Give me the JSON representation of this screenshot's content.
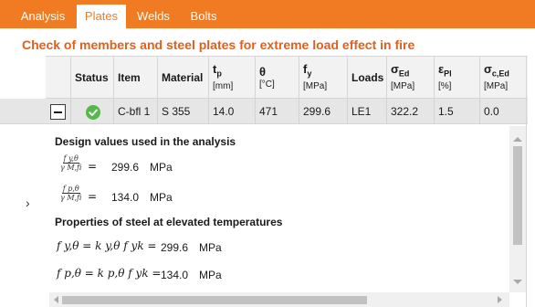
{
  "tabs": [
    {
      "label": "Analysis",
      "active": false
    },
    {
      "label": "Plates",
      "active": true
    },
    {
      "label": "Welds",
      "active": false
    },
    {
      "label": "Bolts",
      "active": false
    }
  ],
  "title": "Check of members and steel plates for extreme load effect in fire",
  "table": {
    "headers": {
      "status": "Status",
      "item": "Item",
      "material": "Material",
      "tp_sym": "t",
      "tp_sub": "p",
      "tp_unit": "[mm]",
      "theta_sym": "θ",
      "theta_unit": "[°C]",
      "fy_sym": "f",
      "fy_sub": "y",
      "fy_unit": "[MPa]",
      "loads": "Loads",
      "sed_sym": "σ",
      "sed_sub": "Ed",
      "sed_unit": "[MPa]",
      "epl_sym": "ε",
      "epl_sub": "Pl",
      "epl_unit": "[%]",
      "sced_sym": "σ",
      "sced_sub": "c,Ed",
      "sced_unit": "[MPa]"
    },
    "row": {
      "status": "ok",
      "item": "C-bfl 1",
      "material": "S 355",
      "tp": "14.0",
      "theta": "471",
      "fy": "299.6",
      "loads": "LE1",
      "sed": "322.2",
      "epl": "1.5",
      "sced": "0.0"
    }
  },
  "details": {
    "section1": "Design values used in the analysis",
    "eq1": {
      "num": "f y,θ",
      "den": "γ M,fi",
      "value": "299.6",
      "unit": "MPa"
    },
    "eq2": {
      "num": "f p,θ",
      "den": "γ M,fi",
      "value": "134.0",
      "unit": "MPa"
    },
    "section2": "Properties of steel at elevated temperatures",
    "eq3": {
      "expr": "f y,θ = k y,θ f yk =",
      "value": "299.6",
      "unit": "MPa"
    },
    "eq4": {
      "expr": "f p,θ = k p,θ f yk =",
      "value": "134.0",
      "unit": "MPa"
    }
  },
  "icons": {
    "status_ok": "check-circle-icon",
    "collapse": "minus-box-icon",
    "expand_arrow": "chevron-right-icon"
  },
  "colors": {
    "accent": "#f07b23",
    "title": "#e0601c",
    "ok": "#54b948",
    "row_bg": "#e6e6e6"
  }
}
